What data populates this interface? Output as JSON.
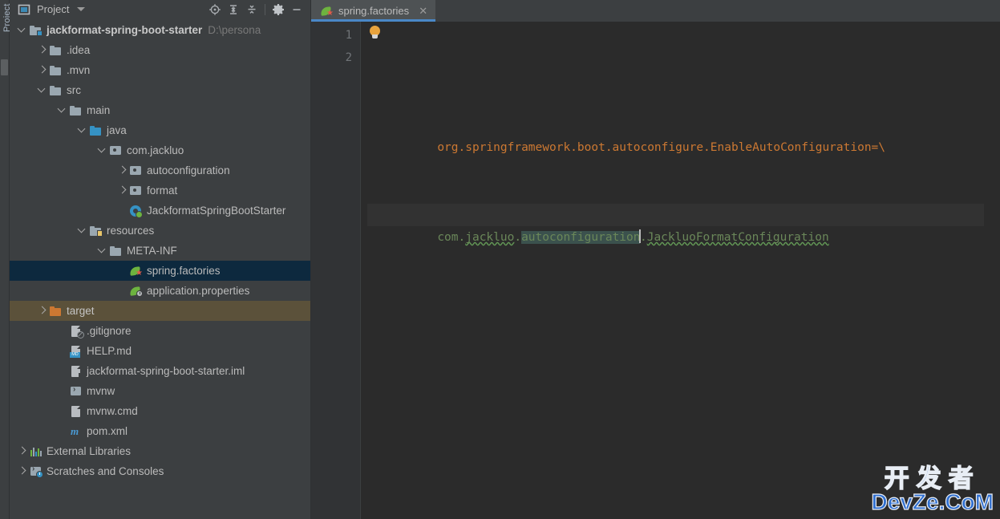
{
  "tool_window": {
    "vertical_tab_label": "Project",
    "title": "Project",
    "title_icon": "project-view-icon",
    "dropdown_icon": "chevron-down-icon",
    "actions": [
      {
        "name": "locate-icon",
        "tooltip": "Select Opened File"
      },
      {
        "name": "expand-all-icon",
        "tooltip": "Expand All"
      },
      {
        "name": "collapse-all-icon",
        "tooltip": "Collapse All"
      },
      {
        "name": "gear-icon",
        "tooltip": "Settings"
      },
      {
        "name": "minimize-icon",
        "tooltip": "Hide"
      }
    ]
  },
  "tree": {
    "nodes": [
      {
        "label": "jackformat-spring-boot-starter",
        "suffix": "D:\\persona",
        "icon": "module-folder-icon",
        "indent": 0,
        "twisty": "down",
        "style": "root",
        "state": "normal"
      },
      {
        "label": ".idea",
        "suffix": "",
        "icon": "folder-icon",
        "indent": 1,
        "twisty": "right",
        "style": "normal",
        "state": "normal"
      },
      {
        "label": ".mvn",
        "suffix": "",
        "icon": "folder-icon",
        "indent": 1,
        "twisty": "right",
        "style": "normal",
        "state": "normal"
      },
      {
        "label": "src",
        "suffix": "",
        "icon": "folder-icon",
        "indent": 1,
        "twisty": "down",
        "style": "normal",
        "state": "normal"
      },
      {
        "label": "main",
        "suffix": "",
        "icon": "folder-icon",
        "indent": 2,
        "twisty": "down",
        "style": "normal",
        "state": "normal"
      },
      {
        "label": "java",
        "suffix": "",
        "icon": "source-root-folder-icon",
        "indent": 3,
        "twisty": "down",
        "style": "normal",
        "state": "normal"
      },
      {
        "label": "com.jackluo",
        "suffix": "",
        "icon": "package-icon",
        "indent": 4,
        "twisty": "down",
        "style": "normal",
        "state": "normal"
      },
      {
        "label": "autoconfiguration",
        "suffix": "",
        "icon": "package-icon",
        "indent": 5,
        "twisty": "right",
        "style": "normal",
        "state": "normal"
      },
      {
        "label": "format",
        "suffix": "",
        "icon": "package-icon",
        "indent": 5,
        "twisty": "right",
        "style": "normal",
        "state": "normal"
      },
      {
        "label": "JackformatSpringBootStarter",
        "suffix": "",
        "icon": "spring-boot-class-icon",
        "indent": 5,
        "twisty": "none",
        "style": "normal",
        "state": "normal"
      },
      {
        "label": "resources",
        "suffix": "",
        "icon": "resource-root-folder-icon",
        "indent": 3,
        "twisty": "down",
        "style": "normal",
        "state": "normal"
      },
      {
        "label": "META-INF",
        "suffix": "",
        "icon": "folder-icon",
        "indent": 4,
        "twisty": "down",
        "style": "normal",
        "state": "normal"
      },
      {
        "label": "spring.factories",
        "suffix": "",
        "icon": "spring-factories-icon",
        "indent": 5,
        "twisty": "none",
        "style": "normal",
        "state": "selected"
      },
      {
        "label": "application.properties",
        "suffix": "",
        "icon": "spring-properties-icon",
        "indent": 5,
        "twisty": "none",
        "style": "normal",
        "state": "normal"
      },
      {
        "label": "target",
        "suffix": "",
        "icon": "excluded-folder-icon",
        "indent": 1,
        "twisty": "right",
        "style": "normal",
        "state": "excluded"
      },
      {
        "label": ".gitignore",
        "suffix": "",
        "icon": "gitignore-file-icon",
        "indent": 2,
        "twisty": "none",
        "style": "normal",
        "state": "normal"
      },
      {
        "label": "HELP.md",
        "suffix": "",
        "icon": "markdown-file-icon",
        "indent": 2,
        "twisty": "none",
        "style": "normal",
        "state": "normal"
      },
      {
        "label": "jackformat-spring-boot-starter.iml",
        "suffix": "",
        "icon": "iml-file-icon",
        "indent": 2,
        "twisty": "none",
        "style": "normal",
        "state": "normal"
      },
      {
        "label": "mvnw",
        "suffix": "",
        "icon": "shell-script-icon",
        "indent": 2,
        "twisty": "none",
        "style": "normal",
        "state": "normal"
      },
      {
        "label": "mvnw.cmd",
        "suffix": "",
        "icon": "cmd-file-icon",
        "indent": 2,
        "twisty": "none",
        "style": "normal",
        "state": "normal"
      },
      {
        "label": "pom.xml",
        "suffix": "",
        "icon": "maven-pom-icon",
        "indent": 2,
        "twisty": "none",
        "style": "normal",
        "state": "normal"
      },
      {
        "label": "External Libraries",
        "suffix": "",
        "icon": "libraries-icon",
        "indent": 0,
        "twisty": "right",
        "style": "normal",
        "state": "normal"
      },
      {
        "label": "Scratches and Consoles",
        "suffix": "",
        "icon": "scratches-icon",
        "indent": 0,
        "twisty": "right",
        "style": "normal",
        "state": "normal"
      }
    ]
  },
  "editor": {
    "tabs": [
      {
        "label": "spring.factories",
        "icon": "spring-factories-icon",
        "close_icon": "close-icon",
        "active": true
      }
    ],
    "line_numbers": [
      "1",
      "2"
    ],
    "intention_icon": "lightbulb-icon",
    "lines": [
      {
        "number": "1",
        "active": false,
        "segments": [
          {
            "text": "org.springframework.boot.autoconfigure.EnableAutoConfiguration=\\",
            "color": "orange",
            "style": "plain"
          }
        ]
      },
      {
        "number": "2",
        "active": true,
        "segments": [
          {
            "text": "com.",
            "color": "green",
            "style": "plain"
          },
          {
            "text": "jackluo",
            "color": "green",
            "style": "squiggle"
          },
          {
            "text": ".",
            "color": "green",
            "style": "plain"
          },
          {
            "text": "autoconfiguration",
            "color": "green",
            "style": "highlight-caret"
          },
          {
            "text": ".",
            "color": "green",
            "style": "plain"
          },
          {
            "text": "JackluoFormatConfiguration",
            "color": "green",
            "style": "squiggle"
          }
        ]
      }
    ],
    "full_text_line_1": "org.springframework.boot.autoconfigure.EnableAutoConfiguration=\\",
    "full_text_line_2": "com.jackluo.autoconfiguration.JackluoFormatConfiguration"
  },
  "watermark": {
    "chinese": "开发者",
    "latin": "DevZe.CoM"
  },
  "colors": {
    "panel_bg": "#3c3f41",
    "editor_bg": "#2b2b2b",
    "gutter_bg": "#313335",
    "selection_bg": "#0d293e",
    "excluded_bg": "#5b513a",
    "tab_active_bg": "#4e5254",
    "tab_underline": "#4a88c7",
    "text": "#bbbbbb",
    "code_orange": "#cc7832",
    "code_green": "#6a8759",
    "accent_blue": "#3592c4",
    "spring_green": "#6db33f",
    "watermark_blue": "#2f6fd0"
  }
}
